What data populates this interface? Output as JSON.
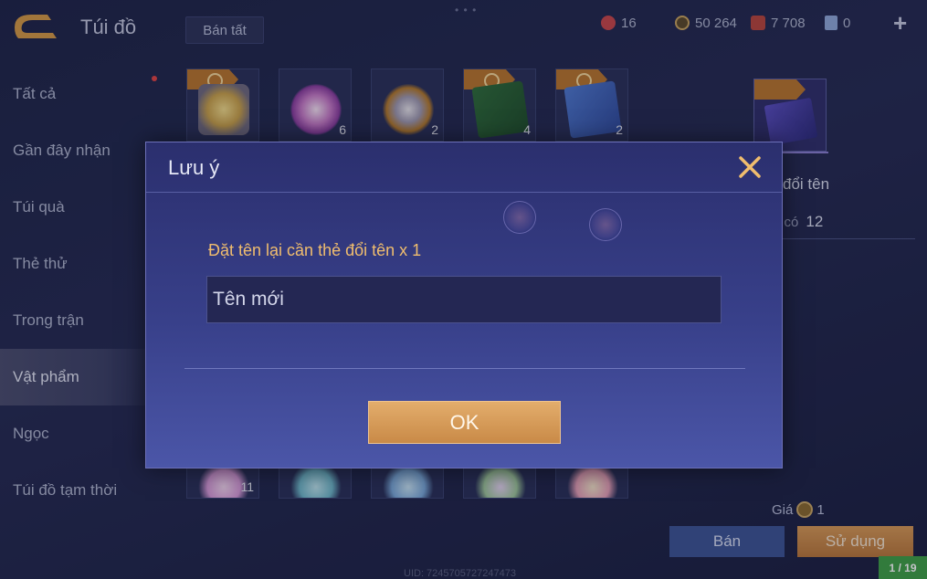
{
  "header": {
    "title": "Túi đồ",
    "sell_all_label": "Bán tất",
    "currencies": [
      {
        "icon": "red-gem-icon",
        "value": "16",
        "color": "#d8574a"
      },
      {
        "icon": "gold-coin-icon",
        "value": "50 264",
        "color": "#c9a55e"
      },
      {
        "icon": "ruby-icon",
        "value": "7 708",
        "color": "#c9554a"
      },
      {
        "icon": "card-token-icon",
        "value": "0",
        "color": "#8fa9d8"
      }
    ]
  },
  "sidebar": {
    "items": [
      {
        "label": "Tất cả"
      },
      {
        "label": "Gần đây nhận"
      },
      {
        "label": "Túi quà"
      },
      {
        "label": "Thẻ thử"
      },
      {
        "label": "Trong trận"
      },
      {
        "label": "Vật phẩm"
      },
      {
        "label": "Ngọc"
      },
      {
        "label": "Túi đồ tạm thời"
      }
    ],
    "active_index": 5
  },
  "grid": {
    "top_row": [
      {
        "name": "star-ticket-item",
        "count": ""
      },
      {
        "name": "pink-orb-item",
        "count": "6"
      },
      {
        "name": "horn-item",
        "count": "2"
      },
      {
        "name": "gold-x2-card-item",
        "count": "4"
      },
      {
        "name": "exp-x2-card-item",
        "count": "2"
      }
    ],
    "bottom_row": [
      {
        "name": "pink-flower-item",
        "count": "11"
      },
      {
        "name": "blue-cake-item",
        "count": ""
      },
      {
        "name": "blue-flower-item",
        "count": ""
      },
      {
        "name": "flower-cake-item",
        "count": ""
      },
      {
        "name": "pink-cake-item",
        "count": ""
      }
    ]
  },
  "detail": {
    "name": "đổi tên",
    "owned_label": "ã có",
    "owned_value": "12",
    "price_label": "Giá",
    "price_value": "1",
    "sell_label": "Bán",
    "use_label": "Sử dụng"
  },
  "footer": {
    "uid": "UID: 7245705727247473",
    "page_badge": "1 / 19"
  },
  "modal": {
    "title": "Lưu ý",
    "label": "Đặt tên lại cần thẻ đổi tên x 1",
    "input_placeholder": "Tên mới",
    "ok_label": "OK"
  },
  "colors": {
    "accent_gold": "#f0bd6e",
    "ok_button": "#d99b58",
    "sell_button": "#3d5594",
    "badge_green": "#3fa046"
  }
}
